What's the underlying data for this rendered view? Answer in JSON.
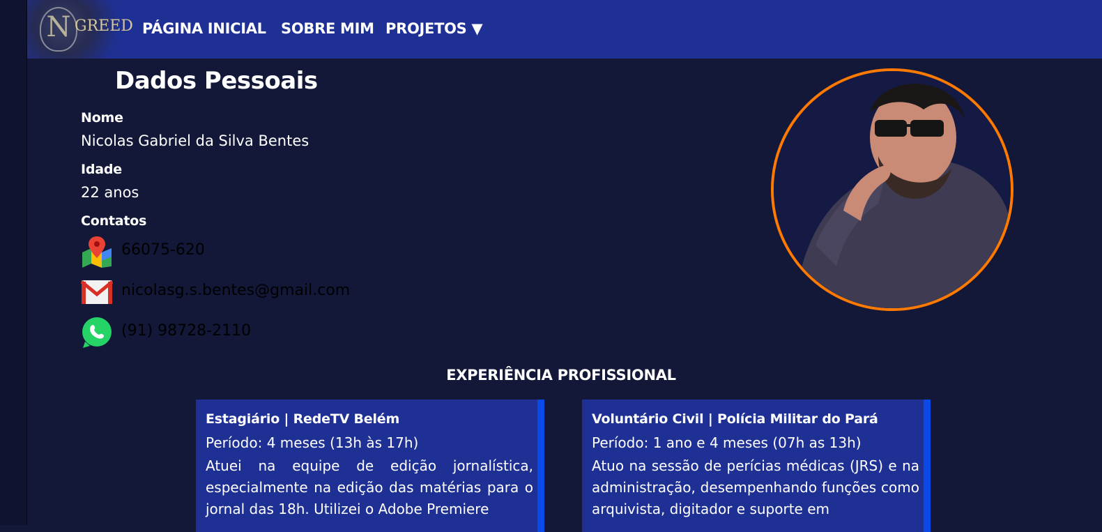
{
  "nav": {
    "logo_text": "GREED",
    "logo_letter": "N",
    "items": [
      {
        "label": "PÁGINA INICIAL"
      },
      {
        "label": "SOBRE MIM"
      },
      {
        "label": "PROJETOS ▼"
      }
    ]
  },
  "personal": {
    "title": "Dados Pessoais",
    "name_label": "Nome",
    "name_value": "Nicolas Gabriel da Silva Bentes",
    "age_label": "Idade",
    "age_value": "22 anos",
    "contacts_label": "Contatos",
    "contacts": [
      {
        "icon": "map-pin-icon",
        "text": "66075-620"
      },
      {
        "icon": "gmail-icon",
        "text": "nicolasg.s.bentes@gmail.com"
      },
      {
        "icon": "whatsapp-icon",
        "text": "(91) 98728-2110"
      }
    ]
  },
  "photo": {
    "border_color": "#ff7a00"
  },
  "experience": {
    "title": "EXPERIÊNCIA PROFISSIONAL",
    "cards": [
      {
        "title": "Estagiário | RedeTV Belém",
        "period": "Período: 4 meses (13h às 17h)",
        "description": "Atuei na equipe de edição jornalística, especialmente na edição das matérias para o jornal das 18h. Utilizei o Adobe Premiere"
      },
      {
        "title": "Voluntário Civil | Polícia Militar do Pará",
        "period": "Período: 1 ano e 4 meses (07h as 13h)",
        "description": "Atuo na sessão de perícias médicas (JRS) e na administração, desempenhando funções como arquivista, digitador e suporte em"
      }
    ]
  },
  "colors": {
    "background": "#131838",
    "navbar": "#1f3095",
    "card": "#1f3095",
    "card_accent": "#0a4ae8",
    "photo_border": "#ff7a00"
  }
}
